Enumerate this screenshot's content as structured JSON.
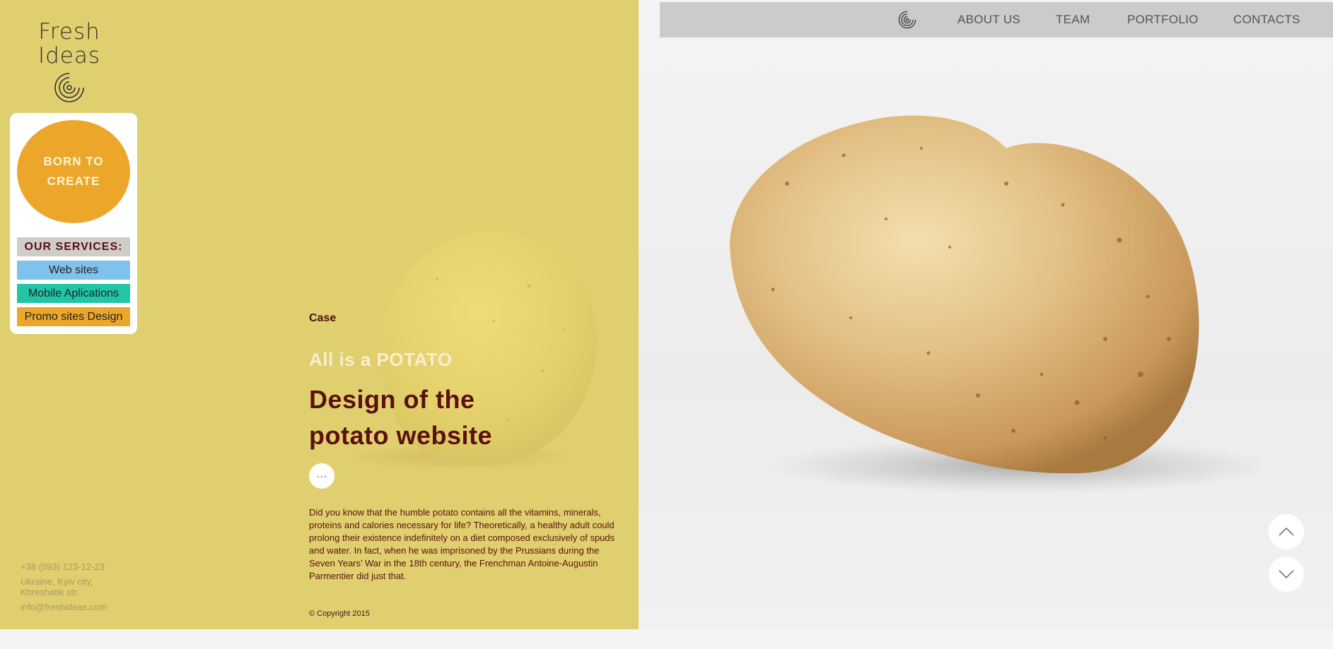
{
  "brand": {
    "logo_line1": "Fresh",
    "logo_line2": "Ideas"
  },
  "services": {
    "badge": "BORN TO CREATE",
    "heading": "OUR SERVICES:",
    "items": [
      "Web sites",
      "Mobile Aplications",
      "Promo sites Design"
    ]
  },
  "contacts": {
    "phone": "+38 (093) 123-12-23",
    "address": "Ukraine, Kyiv city, Khreshatik str.",
    "email": "info@freshideas.com"
  },
  "case": {
    "label": "Case",
    "subtitle": "All is a POTATO",
    "title": "Design of the potato website",
    "more_label": "···",
    "body": "Did you know that the humble potato contains all the vitamins, minerals, proteins and calories necessary for life? Theoretically, a healthy adult could prolong their existence indefinitely on a diet composed exclusively of spuds and water. In fact, when he was imprisoned by the Prussians during the Seven Years’ War in the 18th century, the Frenchman Antoine-Augustin Parmentier did just that.",
    "copyright": "© Copyright 2015"
  },
  "nav": {
    "items": [
      "ABOUT US",
      "TEAM",
      "PORTFOLIO",
      "CONTACTS"
    ]
  },
  "icons": {
    "logo": "spiral-logo-icon",
    "scroll_up": "chevron-up-icon",
    "scroll_down": "chevron-down-icon"
  },
  "colors": {
    "left_panel": "#e0cf6e",
    "accent_orange": "#eca72b",
    "accent_blue": "#7fc3ec",
    "accent_teal": "#22c5a6",
    "title_maroon": "#5a1010",
    "nav_bar": "#cbcbcb"
  }
}
